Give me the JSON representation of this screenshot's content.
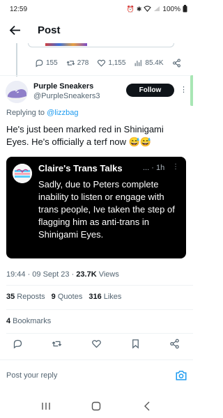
{
  "status_bar": {
    "time": "12:59",
    "battery": "100%",
    "icons": [
      "alarm-icon",
      "bluetooth-icon",
      "wifi-icon",
      "signal-icon",
      "battery-icon"
    ]
  },
  "header": {
    "title": "Post",
    "back_icon": "back-arrow-icon"
  },
  "previous_tweet_metrics": {
    "replies": "155",
    "reposts": "278",
    "likes": "1,155",
    "views": "85.4K"
  },
  "tweet": {
    "author_name": "Purple Sneakers",
    "author_handle": "@PurpleSneakers3",
    "follow_label": "Follow",
    "replying_prefix": "Replying to ",
    "replying_to": "@lizzbag",
    "text": "He's just been marked red in Shinigami Eyes. He's officially a terf now 😅😅",
    "embedded": {
      "name": "Claire's Trans Talks",
      "dots": "...",
      "time": "· 1h",
      "text": "Sadly, due to Peters complete inability to listen or engage with trans people, Ive taken the step of flagging him as anti-trans in Shinigami Eyes."
    },
    "timestamp": "19:44 · 09 Sept 23 · ",
    "views_count": "23.7K",
    "views_label": " Views",
    "stats": {
      "reposts_count": "35",
      "reposts_label": " Reposts",
      "quotes_count": "9",
      "quotes_label": " Quotes",
      "likes_count": "316",
      "likes_label": " Likes"
    },
    "bookmarks_count": "4",
    "bookmarks_label": " Bookmarks"
  },
  "reply_bar": {
    "placeholder": "Post your reply"
  },
  "colors": {
    "accent": "#1d9bf0",
    "follow_bg": "#0f1419",
    "embed_bg": "#000000",
    "muted": "#536471"
  }
}
